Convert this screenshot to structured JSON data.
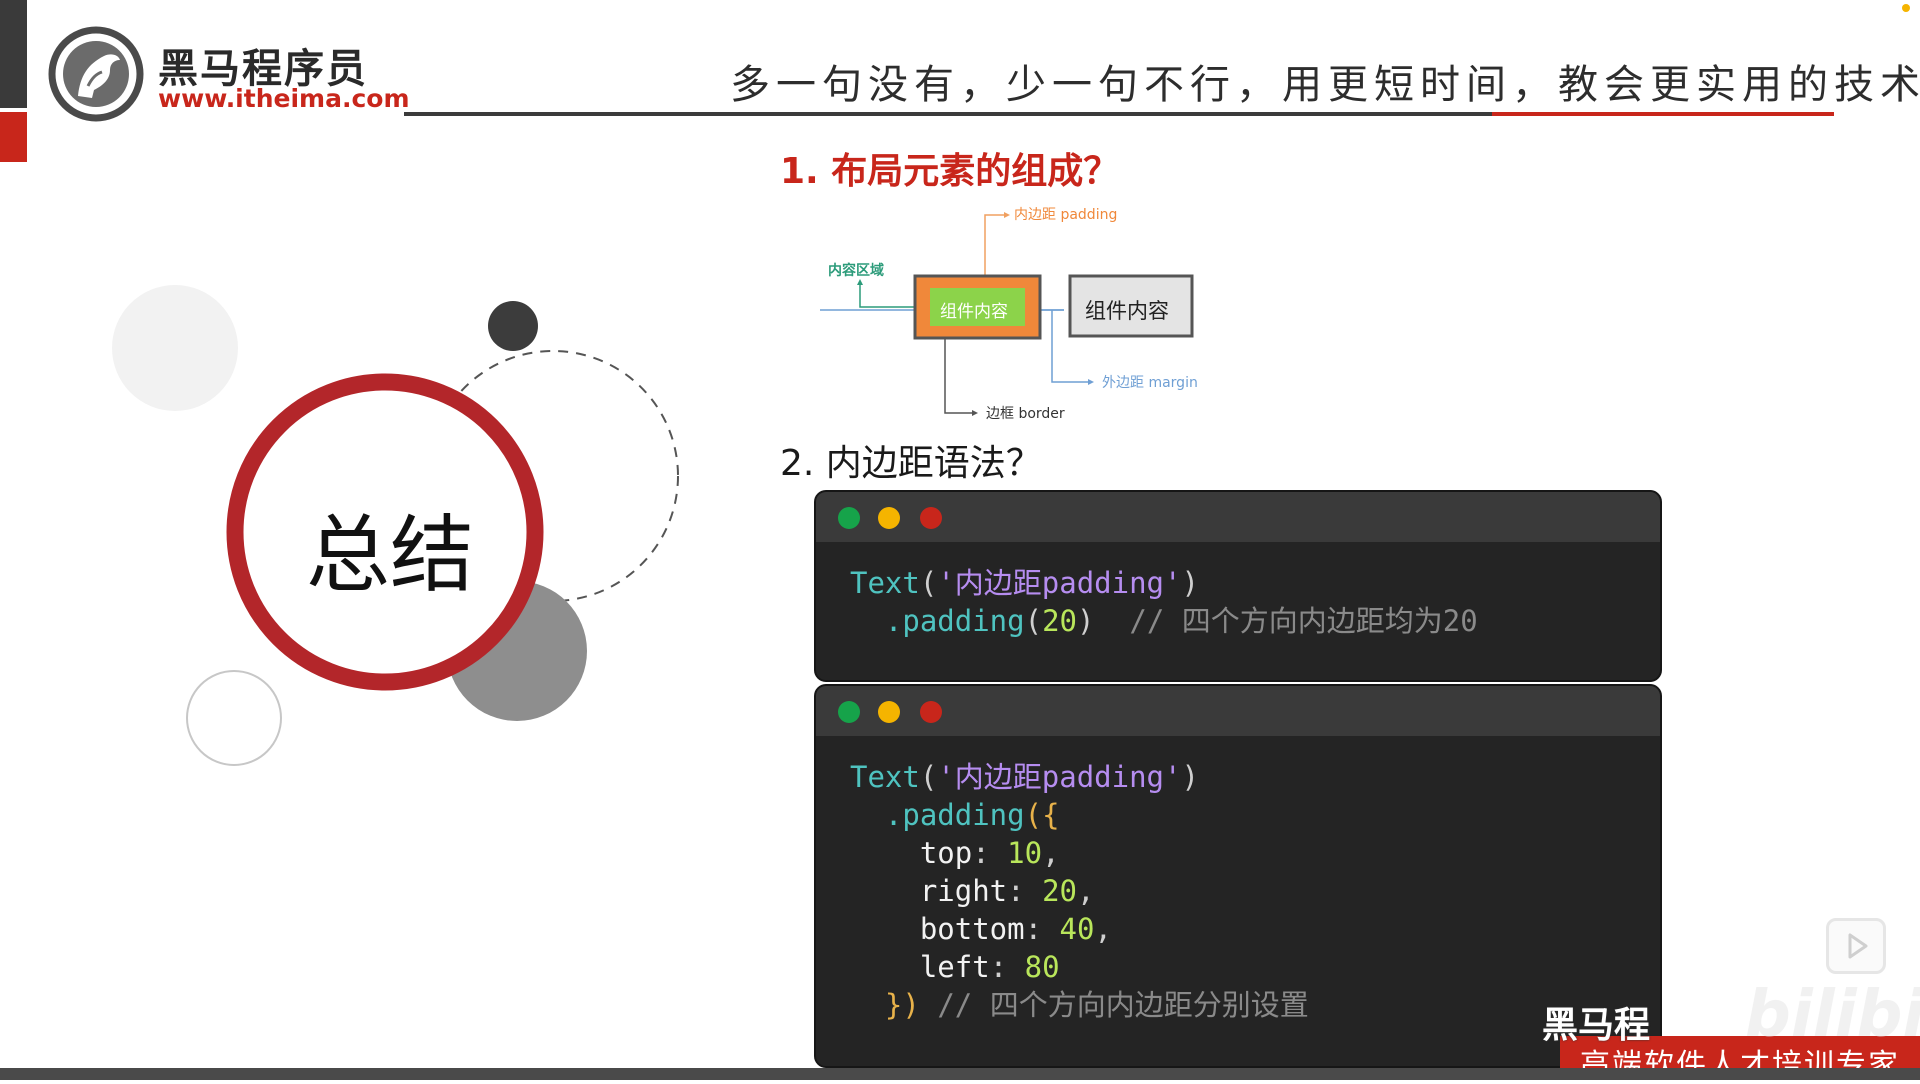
{
  "brand": {
    "title": "黑马程序员",
    "url": "www.itheima.com"
  },
  "slogan": "多一句没有，少一句不行，用更短时间，教会更实用的技术！",
  "summary_label": "总结",
  "section1": {
    "heading": "1. 布局元素的组成？",
    "diagram": {
      "padding_label": "内边距 padding",
      "content_area_label": "内容区域",
      "inner_content": "组件内容",
      "outer_content": "组件内容",
      "margin_label": "外边距 margin",
      "border_label": "边框 border"
    }
  },
  "section2": {
    "heading": "2. 内边距语法？",
    "code1": {
      "l1_fn": "Text",
      "l1_open": "(",
      "l1_str": "'内边距padding'",
      "l1_close": ")",
      "l2_method": ".padding",
      "l2_open": "(",
      "l2_num": "20",
      "l2_close": ")",
      "l2_comment": "// 四个方向内边距均为20"
    },
    "code2": {
      "l1_fn": "Text",
      "l1_open": "(",
      "l1_str": "'内边距padding'",
      "l1_close": ")",
      "l2_method": ".padding",
      "l2_open": "({",
      "top_key": "top",
      "top_val": "10",
      "right_key": "right",
      "right_val": "20",
      "bottom_key": "bottom",
      "bottom_val": "40",
      "left_key": "left",
      "left_val": "80",
      "close": "})",
      "comment": "// 四个方向内边距分别设置"
    }
  },
  "footer": {
    "watermark_brand": "黑马程",
    "watermark_bili": "bilibili",
    "tagline": "高端软件人才培训专家"
  },
  "colors": {
    "brand_red": "#c8261b",
    "code_bg": "#242424",
    "orange_border": "#f0883a",
    "green_content": "#8cd34a"
  }
}
